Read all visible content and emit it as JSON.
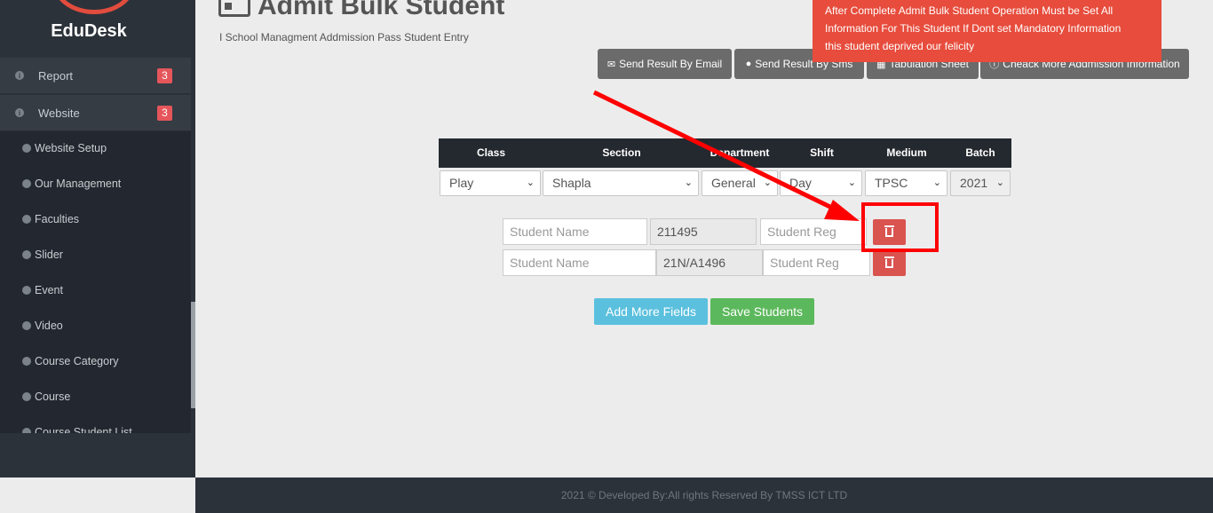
{
  "sidebar": {
    "brand": "EduDesk",
    "menu": [
      {
        "label": "Report",
        "badge": "3"
      },
      {
        "label": "Website",
        "badge": "3"
      }
    ],
    "submenu": [
      "Website Setup",
      "Our Management",
      "Faculties",
      "Slider",
      "Event",
      "Video",
      "Course Category",
      "Course",
      "Course Student List"
    ]
  },
  "header": {
    "title": "Admit Bulk Student",
    "breadcrumb": "I School Managment Addmission Pass Student Entry"
  },
  "alert": {
    "line1": "After Complete Admit Bulk Student Operation Must be Set All",
    "line2": "Information For This Student If Dont set Mandatory Information",
    "line3": "this student deprived our felicity"
  },
  "actions": {
    "email": "Send Result By Email",
    "sms": "Send Result By Sms",
    "tabulation": "Tabulation Sheet",
    "admission": "Cheack More Addmission Information"
  },
  "table": {
    "headers": [
      "Class",
      "Section",
      "Department",
      "Shift",
      "Medium",
      "Batch"
    ],
    "values": [
      "Play",
      "Shapla",
      "General",
      "Day",
      "TPSC",
      "2021"
    ]
  },
  "students": [
    {
      "name_placeholder": "Student Name",
      "id": "211495",
      "reg_placeholder": "Student Reg"
    },
    {
      "name_placeholder": "Student Name",
      "id": "21N/A1496",
      "reg_placeholder": "Student Reg"
    }
  ],
  "buttons": {
    "add_more": "Add More Fields",
    "save": "Save Students"
  },
  "footer": "2021 © Developed By:All rights Reserved By TMSS ICT LTD",
  "colors": {
    "sidebar": "#2c323a",
    "alert": "#e74c3c",
    "danger": "#d9534f",
    "info": "#5bc0de",
    "success": "#5cb85c",
    "annotation": "#ff0000"
  }
}
